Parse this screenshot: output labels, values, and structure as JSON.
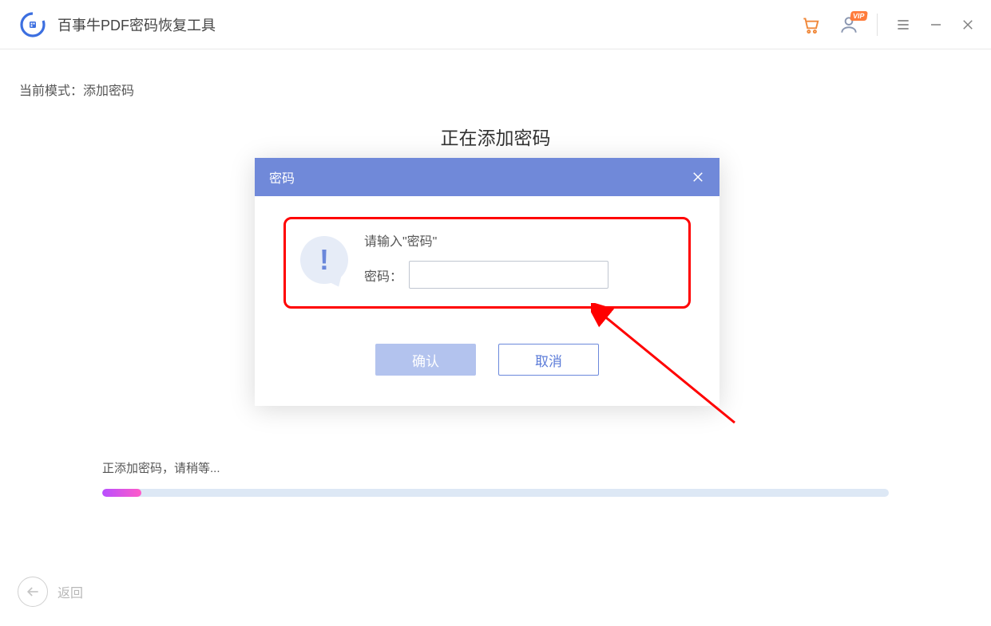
{
  "titlebar": {
    "app_title": "百事牛PDF密码恢复工具",
    "vip_badge": "VIP"
  },
  "content": {
    "mode_label_prefix": "当前模式：",
    "mode_value": "添加密码",
    "main_heading": "正在添加密码"
  },
  "dialog": {
    "title": "密码",
    "prompt": "请输入\"密码\"",
    "input_label": "密码：",
    "input_value": "",
    "confirm": "确认",
    "cancel": "取消"
  },
  "progress": {
    "text": "正添加密码，请稍等...",
    "percent": 5
  },
  "footer": {
    "back_label": "返回"
  }
}
